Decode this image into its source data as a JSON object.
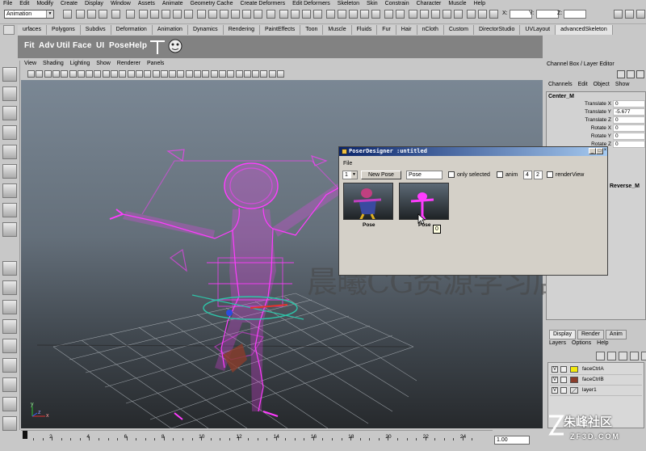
{
  "menu": [
    "File",
    "Edit",
    "Modify",
    "Create",
    "Display",
    "Window",
    "Assets",
    "Animate",
    "Geometry Cache",
    "Create Deformers",
    "Edit Deformers",
    "Skeleton",
    "Skin",
    "Constrain",
    "Character",
    "Muscle",
    "Help"
  ],
  "status_line": {
    "mode": "Animation",
    "coord_labels": {
      "x": "X:",
      "y": "Y:",
      "z": "Z:"
    }
  },
  "shelf_tabs": [
    "urfaces",
    "Polygons",
    "Subdivs",
    "Deformation",
    "Animation",
    "Dynamics",
    "Rendering",
    "PaintEffects",
    "Toon",
    "Muscle",
    "Fluids",
    "Fur",
    "Hair",
    "nCloth",
    "Custom",
    "DirectorStudio",
    "UVLayout",
    "advancedSkeleton"
  ],
  "shelf_tabs_active": "advancedSkeleton",
  "shelf_buttons": [
    "Fit",
    "Adv",
    "Util",
    "Face",
    "UI",
    "PoseHelp"
  ],
  "viewport": {
    "menu": [
      "View",
      "Shading",
      "Lighting",
      "Show",
      "Renderer",
      "Panels"
    ],
    "axis": {
      "x": "x",
      "y": "y",
      "z": "z"
    }
  },
  "channel_box": {
    "title": "Channel Box / Layer Editor",
    "menu": [
      "Channels",
      "Edit",
      "Object",
      "Show"
    ],
    "object": "Center_M",
    "attributes": [
      {
        "label": "Translate X",
        "value": "0"
      },
      {
        "label": "Translate Y",
        "value": "-5.677"
      },
      {
        "label": "Translate Z",
        "value": "0"
      },
      {
        "label": "Rotate X",
        "value": "0"
      },
      {
        "label": "Rotate Y",
        "value": "0"
      },
      {
        "label": "Rotate Z",
        "value": "0"
      }
    ],
    "shape_node": "Reverse_M"
  },
  "layer_editor": {
    "tabs": [
      "Display",
      "Render",
      "Anim"
    ],
    "menu": [
      "Layers",
      "Options",
      "Help"
    ],
    "layers": [
      {
        "visible": "V",
        "name": "faceCtrlA",
        "color": "#f2e80c"
      },
      {
        "visible": "V",
        "name": "faceCtrlB",
        "color": "#8a3c2a"
      },
      {
        "visible": "V",
        "name": "layer1",
        "color": ""
      }
    ]
  },
  "time_slider": {
    "ticks": [
      "2",
      "4",
      "6",
      "8",
      "10",
      "12",
      "14",
      "16",
      "18",
      "20",
      "22",
      "24"
    ],
    "current_frame": "1.00"
  },
  "poser_designer": {
    "title": "PoserDesigner :untitled",
    "menu": "File",
    "page_select": "1",
    "new_pose_label": "New Pose",
    "pose_name_value": "Pose",
    "only_selected_label": "only selected",
    "anim_label": "anim",
    "anim_start": "4",
    "anim_end": "2",
    "render_view_label": "renderView",
    "poses": [
      {
        "label": "Pose"
      },
      {
        "label": "Pose"
      }
    ],
    "tooltip": "0"
  },
  "watermark": "晨曦CG资源学习店",
  "logo": {
    "text": "朱峰社区",
    "url": "ZF3D.COM"
  },
  "colors": {
    "rig_magenta": "#ff3cff",
    "viewport_top": "#7a8794",
    "viewport_bottom": "#26292c",
    "title_bar": "#0a246a"
  }
}
